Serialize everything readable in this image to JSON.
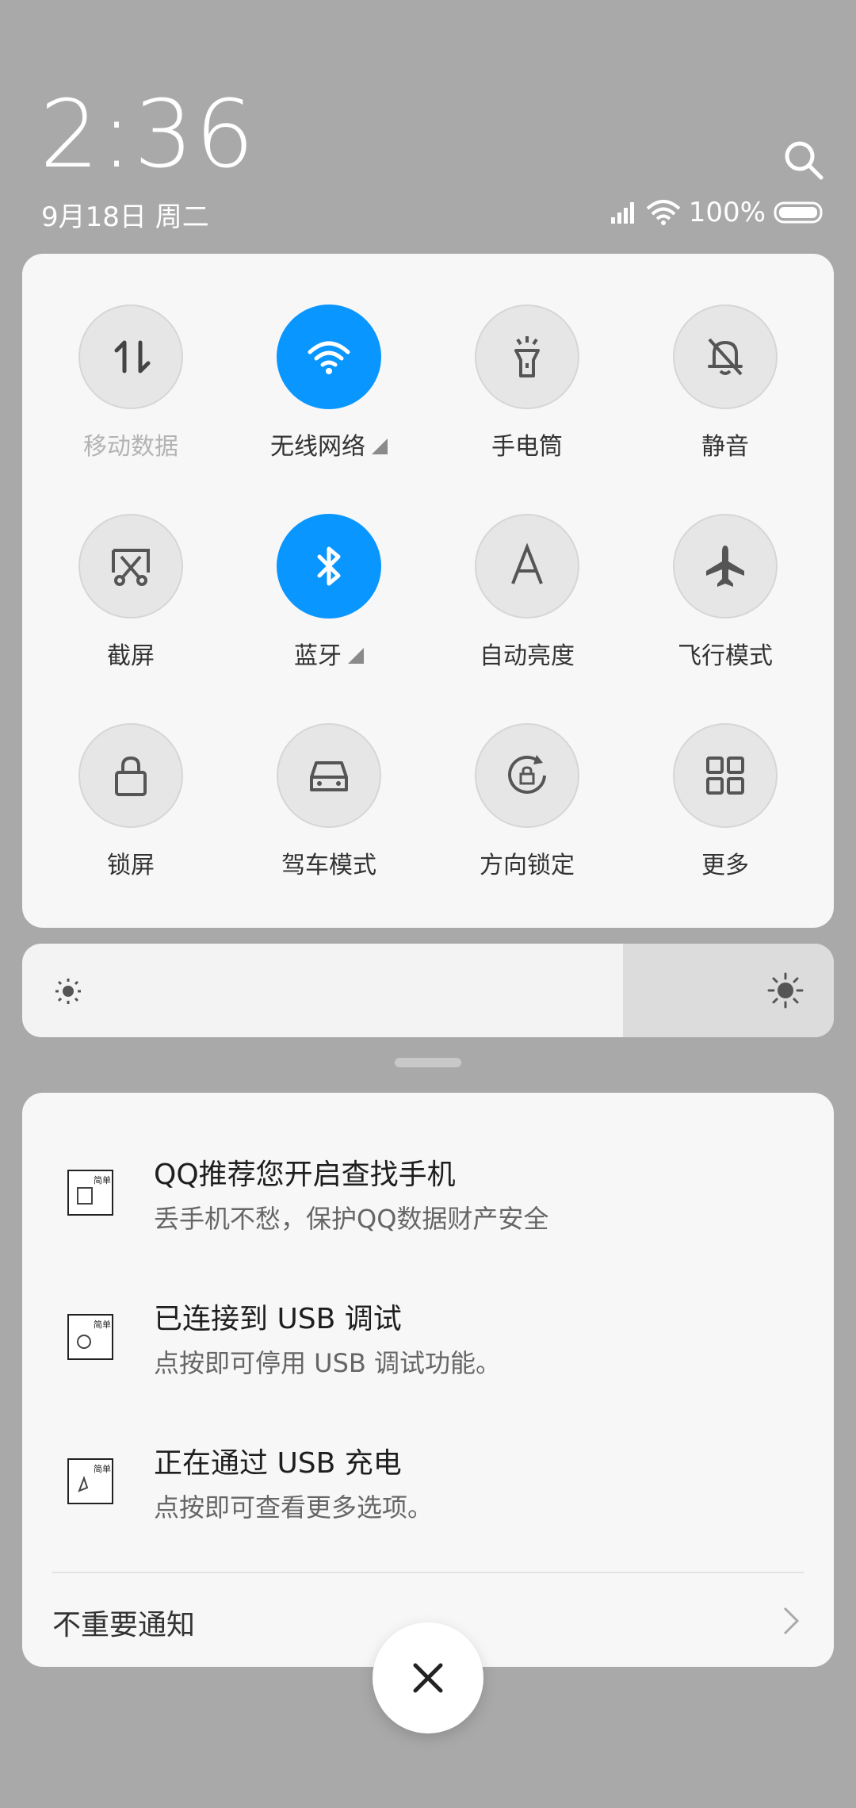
{
  "status": {
    "time": "2:36",
    "date": "9月18日 周二",
    "battery": "100%"
  },
  "quick_settings": [
    {
      "label": "移动数据",
      "icon": "mobile-data-icon",
      "active": false,
      "dim": true,
      "expand": false
    },
    {
      "label": "无线网络",
      "icon": "wifi-icon",
      "active": true,
      "dim": false,
      "expand": true
    },
    {
      "label": "手电筒",
      "icon": "flashlight-icon",
      "active": false,
      "dim": false,
      "expand": false
    },
    {
      "label": "静音",
      "icon": "silent-bell-icon",
      "active": false,
      "dim": false,
      "expand": false
    },
    {
      "label": "截屏",
      "icon": "screenshot-icon",
      "active": false,
      "dim": false,
      "expand": false
    },
    {
      "label": "蓝牙",
      "icon": "bluetooth-icon",
      "active": true,
      "dim": false,
      "expand": true
    },
    {
      "label": "自动亮度",
      "icon": "auto-brightness-icon",
      "active": false,
      "dim": false,
      "expand": false
    },
    {
      "label": "飞行模式",
      "icon": "airplane-icon",
      "active": false,
      "dim": false,
      "expand": false
    },
    {
      "label": "锁屏",
      "icon": "lock-icon",
      "active": false,
      "dim": false,
      "expand": false
    },
    {
      "label": "驾车模式",
      "icon": "car-icon",
      "active": false,
      "dim": false,
      "expand": false
    },
    {
      "label": "方向锁定",
      "icon": "rotation-lock-icon",
      "active": false,
      "dim": false,
      "expand": false
    },
    {
      "label": "更多",
      "icon": "grid-icon",
      "active": false,
      "dim": false,
      "expand": false
    }
  ],
  "brightness": {
    "level": 0.74
  },
  "notifications": [
    {
      "title": "QQ推荐您开启查找手机",
      "body": "丢手机不愁，保护QQ数据财产安全"
    },
    {
      "title": "已连接到 USB 调试",
      "body": "点按即可停用 USB 调试功能。"
    },
    {
      "title": "正在通过 USB 充电",
      "body": "点按即可查看更多选项。"
    }
  ],
  "minor_notifications": {
    "label": "不重要通知"
  },
  "colors": {
    "accent": "#0a96ff",
    "background": "#a9a9a9"
  }
}
